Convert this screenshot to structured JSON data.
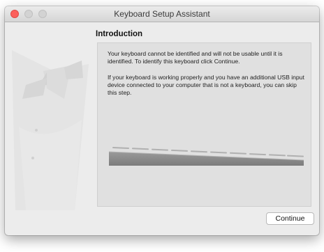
{
  "window": {
    "title": "Keyboard Setup Assistant"
  },
  "page": {
    "heading": "Introduction",
    "paragraphs": [
      "Your keyboard cannot be identified and will not be usable until it is identified. To identify this keyboard click Continue.",
      "If your keyboard is working properly and you have an additional USB input device connected to your computer that is not a keyboard, you can skip this step."
    ]
  },
  "buttons": {
    "continue": "Continue"
  },
  "colors": {
    "close_button": "#fc605c",
    "inactive_button": "#d3d3d3",
    "window_background": "#ececec"
  },
  "icons": {
    "illustration": "tuxedo-illustration",
    "keyboard": "keyboard-illustration"
  }
}
